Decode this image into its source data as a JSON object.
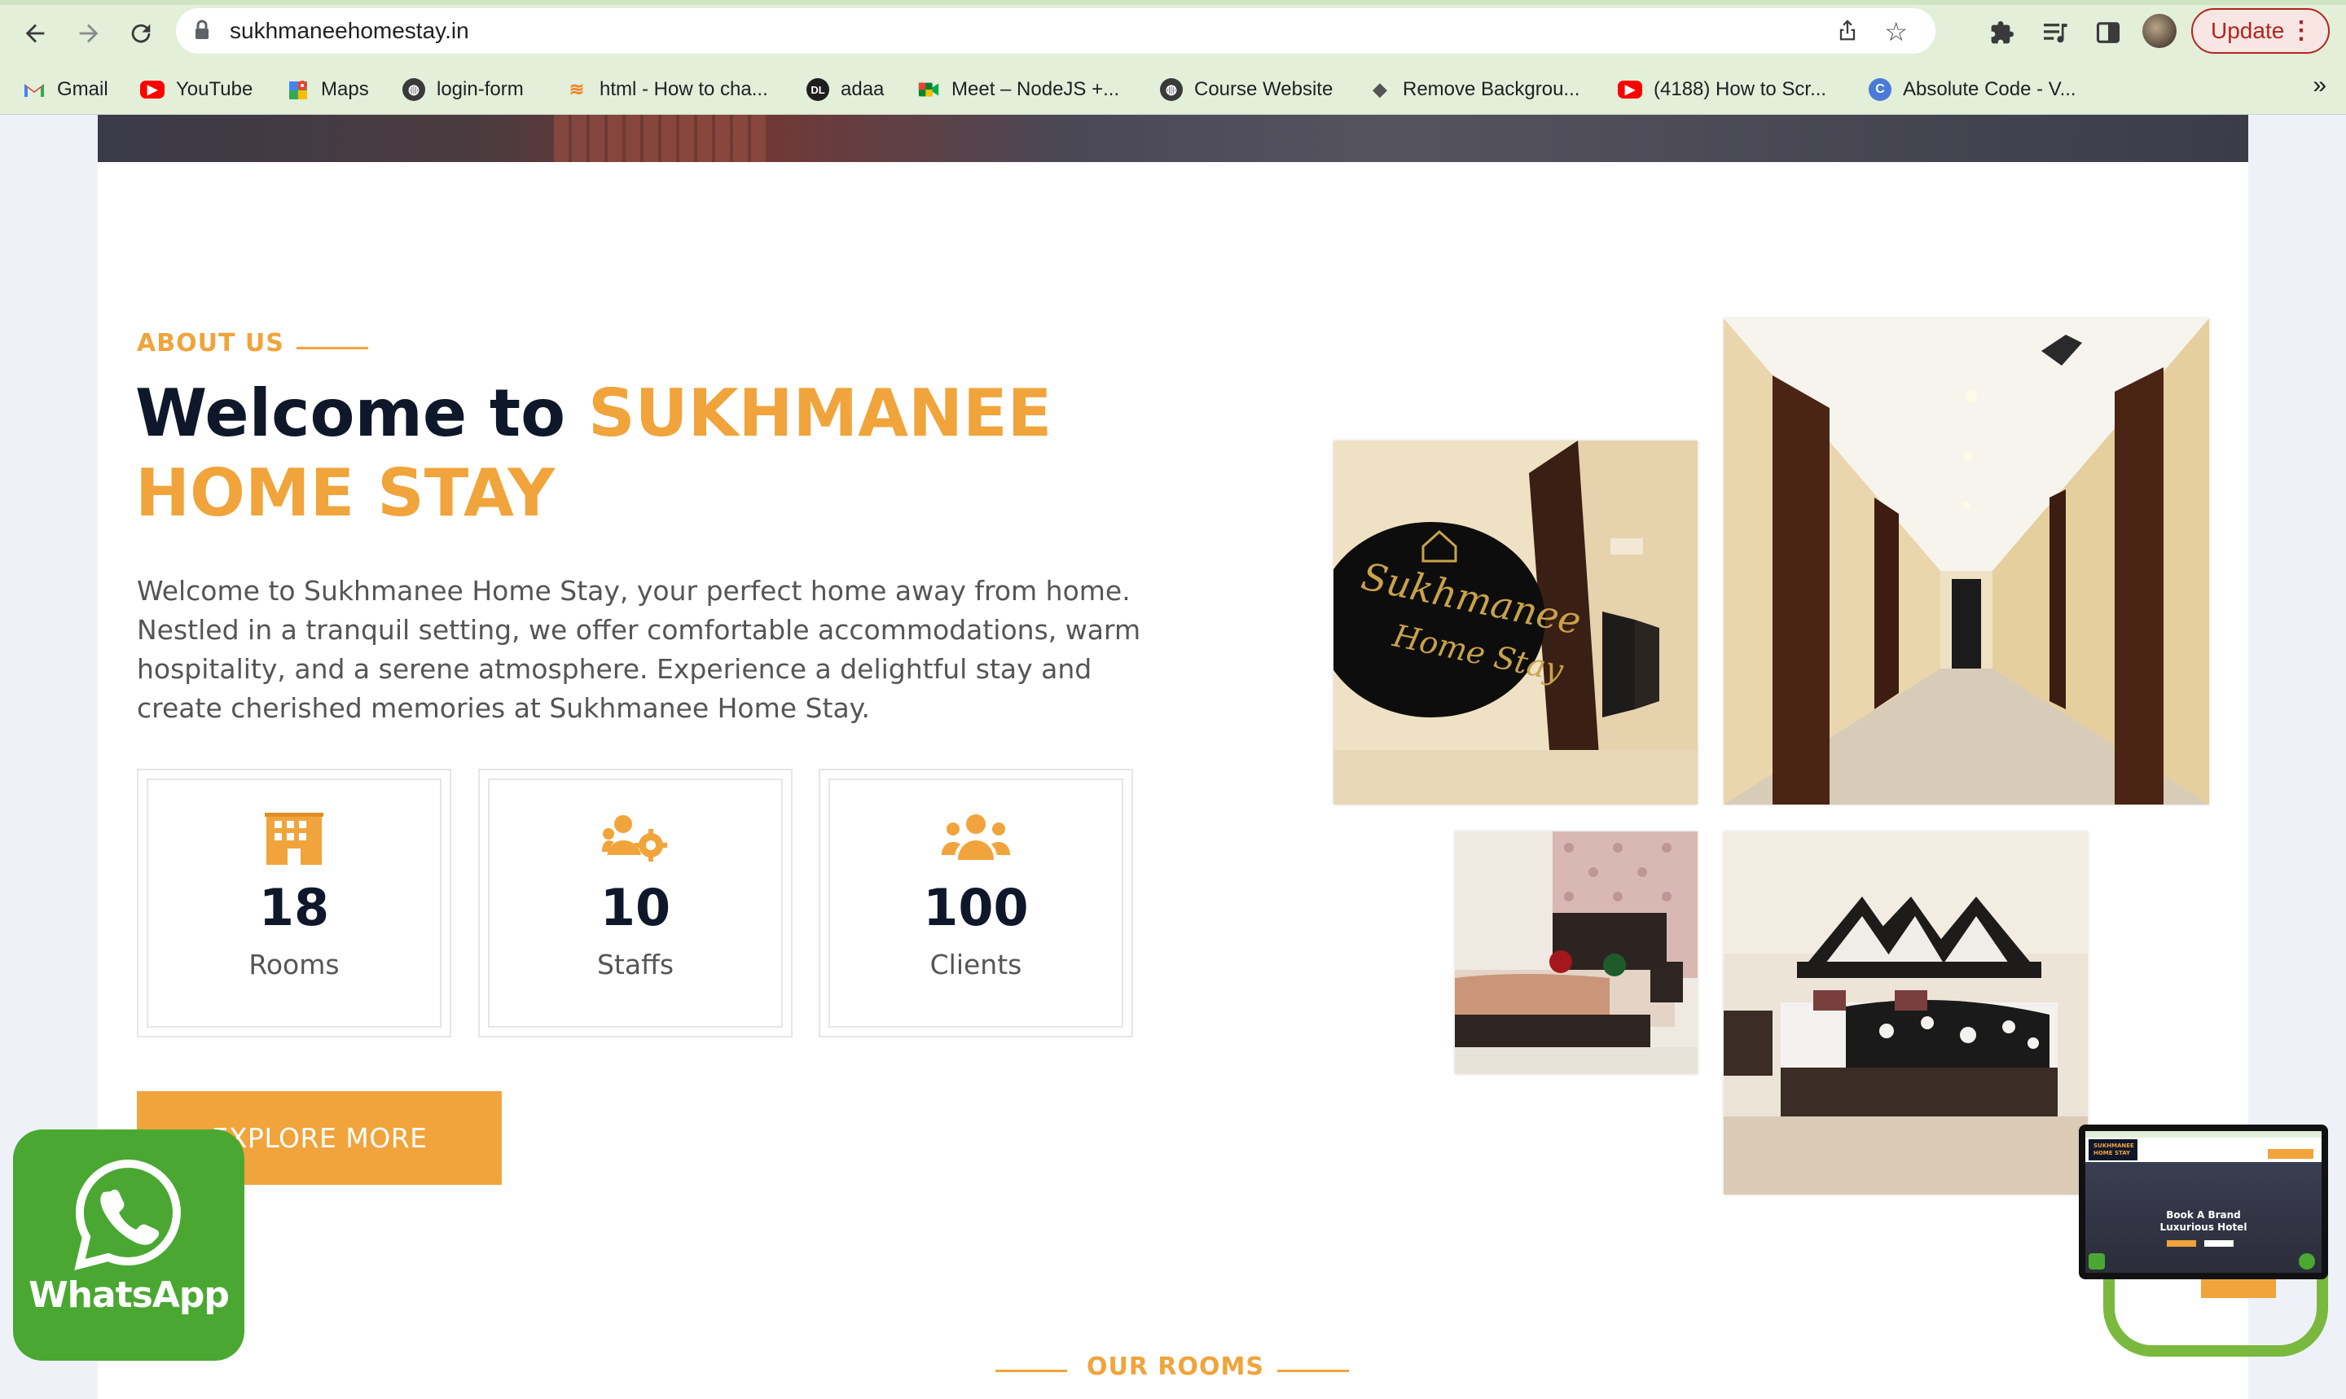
{
  "browser": {
    "url": "sukhmaneehomestay.in",
    "update_label": "Update",
    "more_bookmarks": "»",
    "bookmarks": [
      {
        "label": "Gmail",
        "icon": "gmail-icon"
      },
      {
        "label": "YouTube",
        "icon": "youtube-icon"
      },
      {
        "label": "Maps",
        "icon": "maps-icon"
      },
      {
        "label": "login-form",
        "icon": "globe-icon"
      },
      {
        "label": "html - How to cha...",
        "icon": "stackoverflow-icon"
      },
      {
        "label": "adaa",
        "icon": "adaa-icon"
      },
      {
        "label": "Meet – NodeJS +...",
        "icon": "meet-icon"
      },
      {
        "label": "Course Website",
        "icon": "globe-icon"
      },
      {
        "label": "Remove Backgrou...",
        "icon": "layers-icon"
      },
      {
        "label": "(4188) How to Scr...",
        "icon": "youtube-icon"
      },
      {
        "label": "Absolute Code - V...",
        "icon": "absolute-code-icon"
      }
    ]
  },
  "about": {
    "label": "ABOUT US",
    "title_prefix": "Welcome to ",
    "title_highlight": "SUKHMANEE HOME STAY",
    "paragraph": "Welcome to Sukhmanee Home Stay, your perfect home away from home. Nestled in a tranquil setting, we offer comfortable accommodations, warm hospitality, and a serene atmosphere. Experience a delightful stay and create cherished memories at Sukhmanee Home Stay.",
    "stats": [
      {
        "value": "18",
        "label": "Rooms",
        "icon": "hotel-icon"
      },
      {
        "value": "10",
        "label": "Staffs",
        "icon": "staff-gear-icon"
      },
      {
        "value": "100",
        "label": "Clients",
        "icon": "users-icon"
      }
    ],
    "button": "EXPLORE MORE"
  },
  "gallery": {
    "sign_text_1": "Sukhmanee",
    "sign_text_2": "Home Stay"
  },
  "rooms": {
    "label": "OUR ROOMS"
  },
  "whatsapp": {
    "label": "WhatsApp"
  },
  "pip": {
    "brand_1": "SUKHMANEE",
    "brand_2": "HOME STAY",
    "headline_1": "Book A Brand",
    "headline_2": "Luxurious Hotel"
  },
  "colors": {
    "accent": "#f0a43b",
    "dark": "#0f172b",
    "whatsapp": "#4aa832"
  }
}
